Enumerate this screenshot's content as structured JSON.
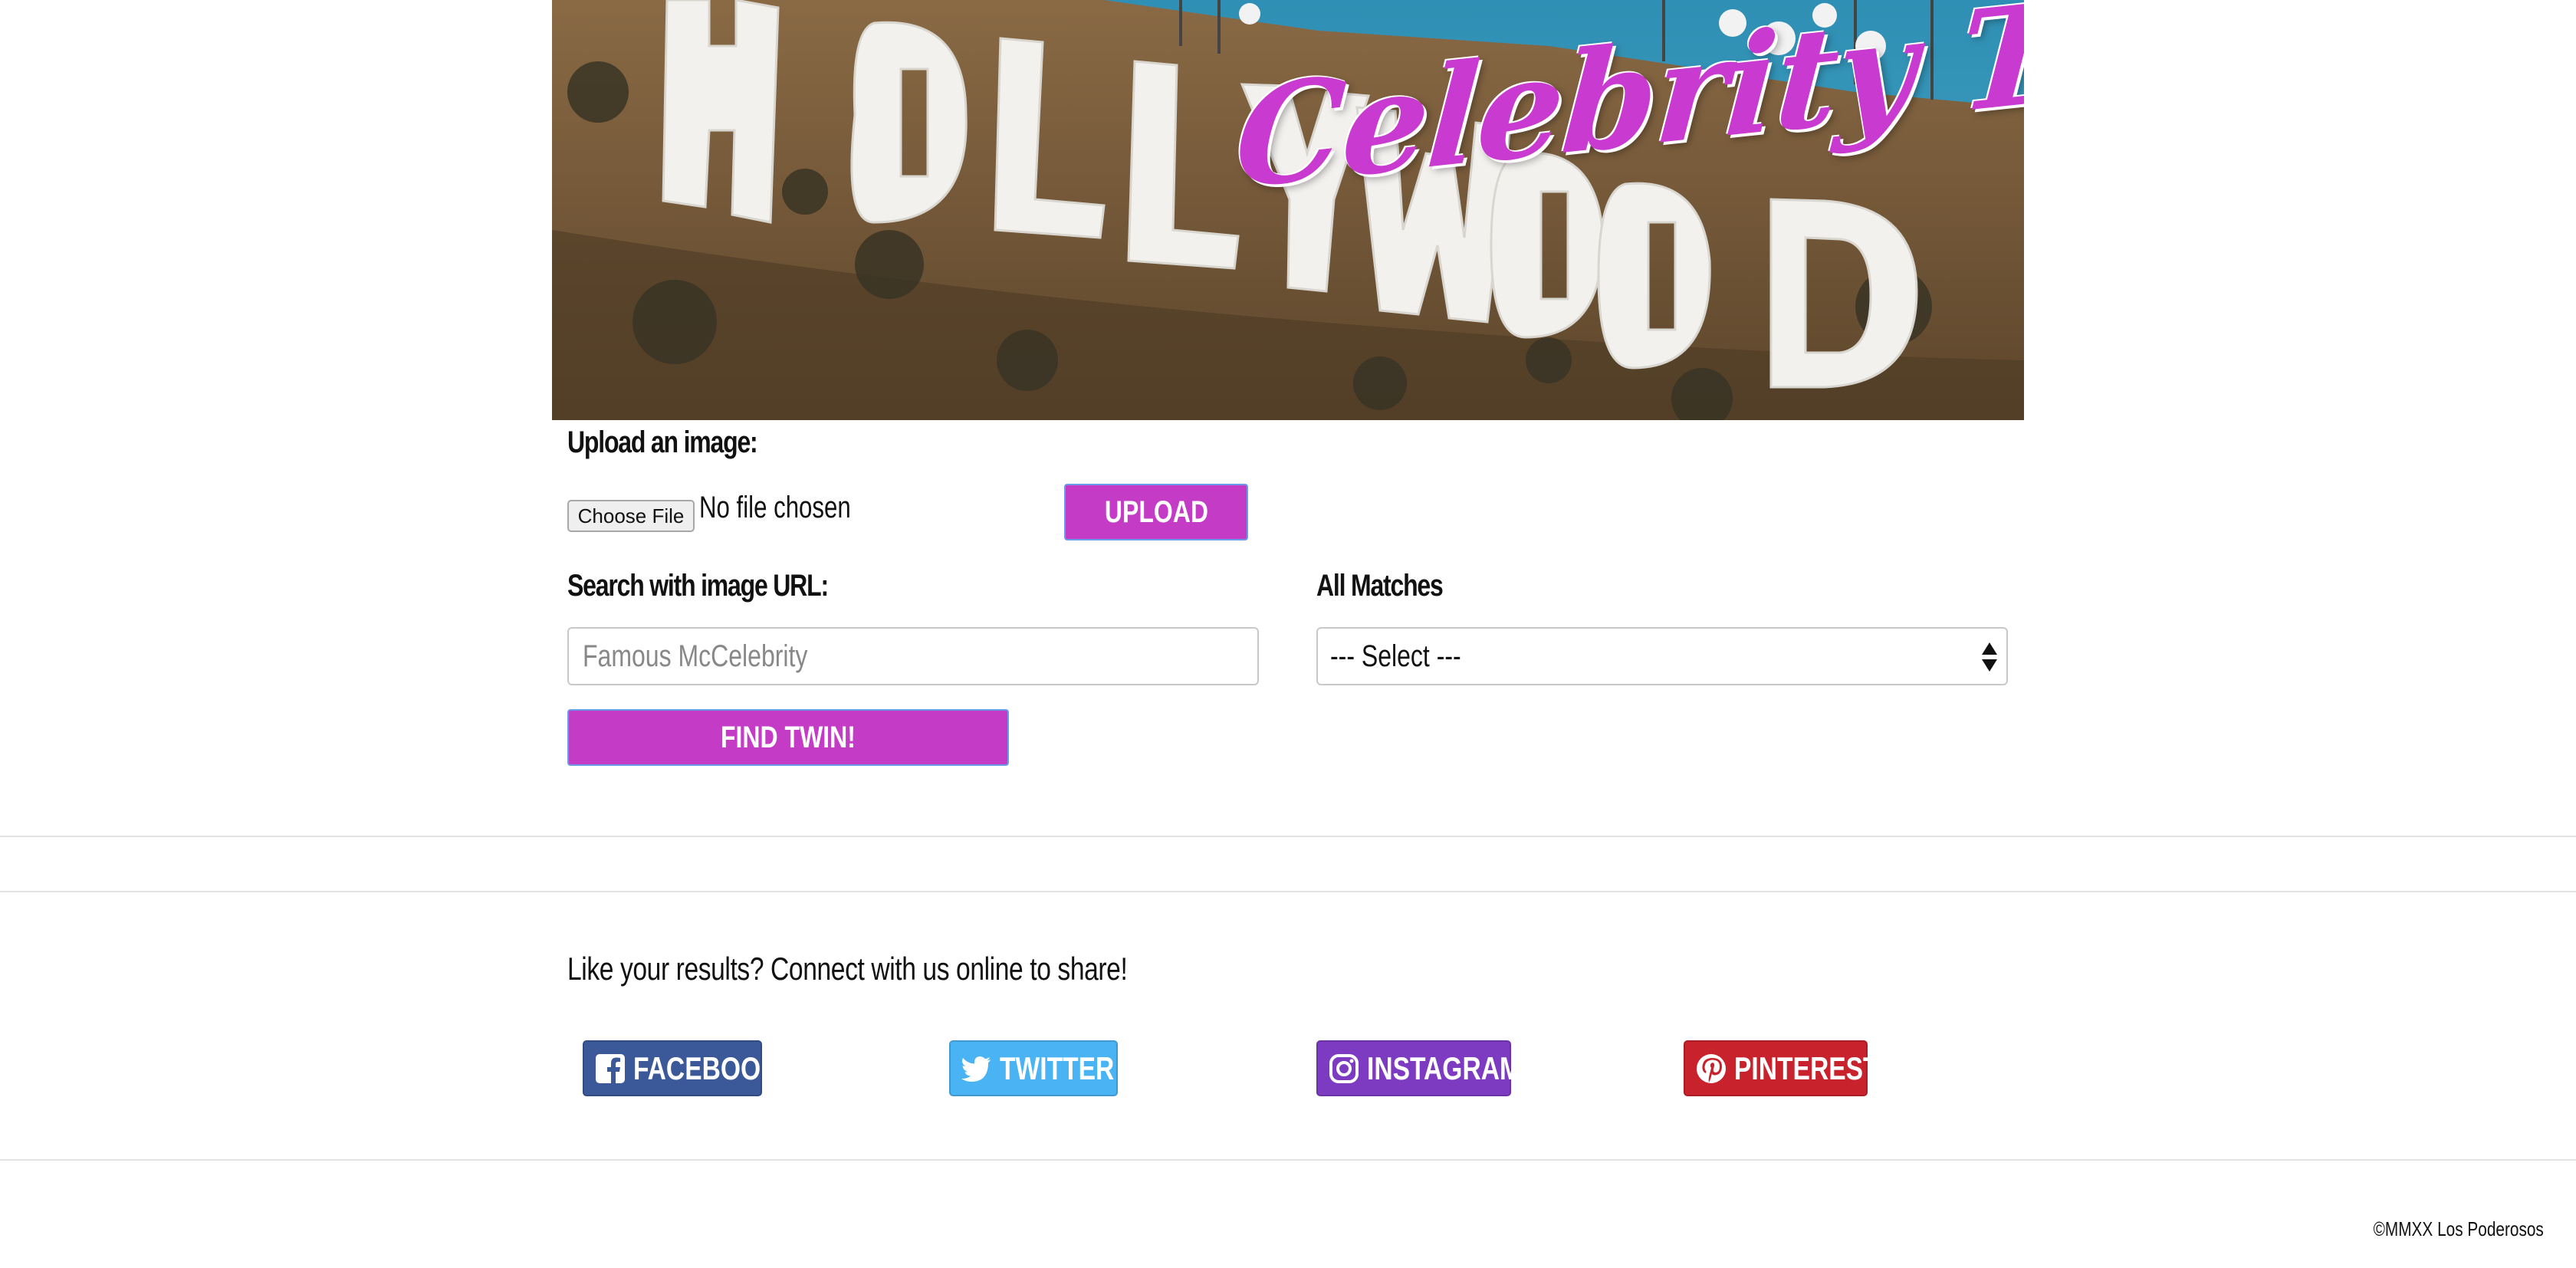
{
  "hero": {
    "title": "Celebrity Twin!",
    "sign_letters": "HOLLYWOOD"
  },
  "upload": {
    "label": "Upload an image:",
    "choose_file_label": "Choose File",
    "no_file_text": "No file chosen",
    "upload_button": "UPLOAD"
  },
  "search": {
    "label": "Search with image URL:",
    "placeholder": "Famous McCelebrity",
    "find_button": "FIND TWIN!"
  },
  "matches": {
    "label": "All Matches",
    "selected": "--- Select ---"
  },
  "share": {
    "text": "Like your results? Connect with us online to share!",
    "buttons": [
      {
        "label": "FACEBOOK",
        "icon": "facebook-icon",
        "color": "#3b5998"
      },
      {
        "label": "TWITTER",
        "icon": "twitter-icon",
        "color": "#4ab3f4"
      },
      {
        "label": "INSTAGRAM",
        "icon": "instagram-icon",
        "color": "#7d3bc2"
      },
      {
        "label": "PINTEREST",
        "icon": "pinterest-icon",
        "color": "#c8232c"
      }
    ]
  },
  "footer": {
    "copyright": "©MMXX Los Poderosos"
  },
  "colors": {
    "accent": "#c43cc6",
    "accent_border": "#6a9ce8"
  }
}
